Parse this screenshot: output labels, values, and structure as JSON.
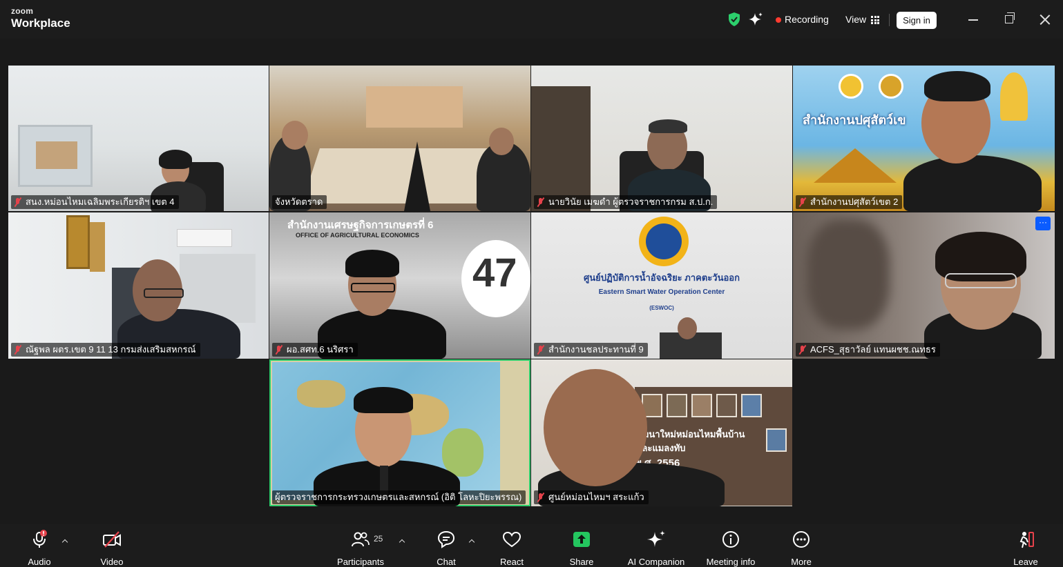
{
  "window": {
    "brand_top": "zoom",
    "brand_bottom": "Workplace",
    "recording_label": "Recording",
    "view_label": "View",
    "signin_label": "Sign in"
  },
  "colors": {
    "background": "#1a1a1a",
    "speaking_border": "#2ccf6c",
    "recording_dot": "#ff3b30",
    "muted_mic": "#e6424b",
    "security_shield": "#2ccf6c"
  },
  "participants": [
    {
      "name": "สนง.หม่อนไหมเฉลิมพระเกียรติฯ เขต 4",
      "muted": true
    },
    {
      "name": "จังหวัดตราด",
      "muted": false
    },
    {
      "name": "นายวินัย เมฆดำ ผู้ตรวจราชการกรม ส.ป.ก.",
      "muted": true
    },
    {
      "name": "สำนักงานปศุสัตว์เขต 2",
      "muted": true
    },
    {
      "name": "ณัฐพล ผตร.เขต 9 11 13 กรมส่งเสริมสหกรณ์",
      "muted": true
    },
    {
      "name": "ผอ.สศท.6 นริศรา",
      "muted": true
    },
    {
      "name": "สำนักงานชลประทานที่ 9",
      "muted": true
    },
    {
      "name": "ACFS_สุธาวัลย์ แทนผชช.ณทธร",
      "muted": true
    },
    {
      "name": "ผู้ตรวจราชการกระทรวงเกษตรและสหกรณ์ (อิติ โลหะปิยะพรรณ)",
      "muted": false
    },
    {
      "name": "ศูนย์หม่อนไหมฯ สระแก้ว",
      "muted": true
    }
  ],
  "tile_texts": {
    "oae_title": "สำนักงานเศรษฐกิจการเกษตรที่ 6",
    "oae_subtitle": "OFFICE OF AGRICULTURAL ECONOMICS",
    "oae_number": "47",
    "livestock_banner": "สำนักงานปศุสัตว์เข",
    "eswoc_thai": "ศูนย์ปฏิบัติการน้ำอัจฉริยะ ภาคตะวันออก",
    "eswoc_eng": "Eastern Smart Water Operation Center",
    "eswoc_abbr": "(ESWOC)",
    "sericulture_sign_1": "พัฒนาใหม่หม่อนไหมพื้นบ้าน",
    "sericulture_sign_2": "และแมลงทับ",
    "sericulture_sign_3": "พ.ศ. 2556",
    "more_dots": "···"
  },
  "toolbar": {
    "audio": "Audio",
    "video": "Video",
    "participants": "Participants",
    "participant_count": "25",
    "chat": "Chat",
    "react": "React",
    "share": "Share",
    "ai_companion": "AI Companion",
    "meeting_info": "Meeting info",
    "more": "More",
    "leave": "Leave"
  }
}
